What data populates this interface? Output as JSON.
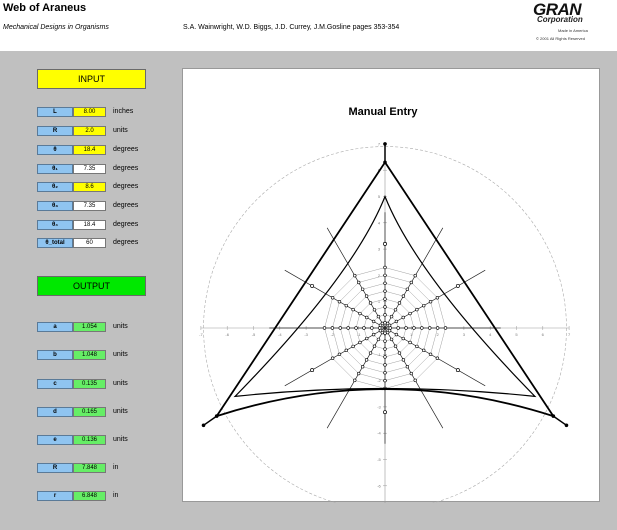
{
  "header": {
    "title": "Web of Araneus",
    "subtitle": "Mechanical Designs in Organisms",
    "authors": "S.A. Wainwright, W.D. Biggs, J.D. Currey, J.M.Gosline   pages 353-354",
    "logo_main": "GRAN",
    "logo_corp": "Corporation",
    "logo_made": "Made in America",
    "logo_copy": "© 2001 All Rights Reserved"
  },
  "input": {
    "label": "INPUT",
    "rows": [
      {
        "param": "L",
        "value": "8.00",
        "unit": "inches"
      },
      {
        "param": "R",
        "value": "2.0",
        "unit": "units"
      },
      {
        "param": "θ",
        "value": "18.4",
        "unit": "degrees"
      },
      {
        "param": "θ₁",
        "value": "7.35",
        "unit": "degrees"
      },
      {
        "param": "θ₂",
        "value": "8.6",
        "unit": "degrees"
      },
      {
        "param": "θ₃",
        "value": "7.35",
        "unit": "degrees"
      },
      {
        "param": "θ₄",
        "value": "18.4",
        "unit": "degrees"
      },
      {
        "param": "θ_total",
        "value": "60",
        "unit": "degrees"
      }
    ]
  },
  "output": {
    "label": "OUTPUT",
    "rows": [
      {
        "param": "a",
        "value": "1.054",
        "unit": "units"
      },
      {
        "param": "b",
        "value": "1.048",
        "unit": "units"
      },
      {
        "param": "c",
        "value": "0.135",
        "unit": "units"
      },
      {
        "param": "d",
        "value": "0.165",
        "unit": "units"
      },
      {
        "param": "e",
        "value": "0.136",
        "unit": "units"
      },
      {
        "param": "R",
        "value": "7.848",
        "unit": "in"
      },
      {
        "param": "r",
        "value": "6.848",
        "unit": "in"
      }
    ]
  },
  "colors": {
    "input_button": "#ffff00",
    "output_button": "#00e800",
    "param_label": "#8fc4f0",
    "background": "#c0c0c0"
  },
  "chart_data": {
    "type": "scatter",
    "title": "Manual Entry",
    "xlim": [
      -7,
      7
    ],
    "ylim": [
      -7,
      7
    ],
    "x_ticks": [
      "-7",
      "-6",
      "-5",
      "-4",
      "-3",
      "-2",
      "-1",
      "0",
      "1",
      "2",
      "3",
      "4",
      "5",
      "6",
      "7"
    ],
    "y_ticks": [
      "7",
      "6",
      "5",
      "4",
      "3",
      "2",
      "1",
      "0",
      "-1",
      "-2",
      "-3",
      "-4",
      "-5",
      "-6",
      "-7"
    ],
    "grid": false,
    "frame_vertices": [
      [
        0,
        6.3
      ],
      [
        -6.4,
        -3.35
      ],
      [
        6.4,
        -3.35
      ]
    ],
    "frame_inner": [
      [
        0,
        5.0
      ],
      [
        -5.7,
        -2.6
      ],
      [
        5.7,
        -2.6
      ]
    ],
    "reference_circle_radius": 6.9,
    "spiral_radii": [
      0.2,
      0.5,
      0.8,
      1.1,
      1.4,
      1.7,
      2.0,
      2.3
    ],
    "radial_count": 12
  }
}
